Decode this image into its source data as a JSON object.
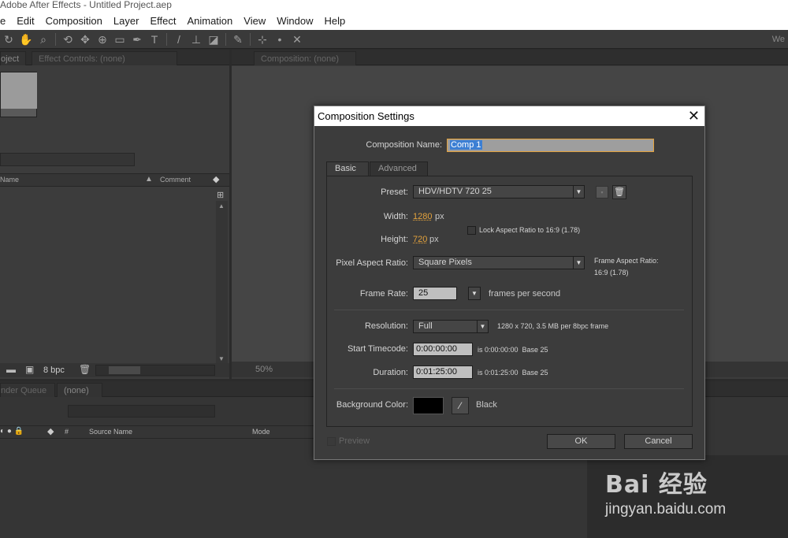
{
  "app": {
    "title": "Adobe After Effects - Untitled Project.aep",
    "menu": [
      "e",
      "Edit",
      "Composition",
      "Layer",
      "Effect",
      "Animation",
      "View",
      "Window",
      "Help"
    ],
    "workspace": "We"
  },
  "project_panel": {
    "tab_project": "oject",
    "tab_effect_controls": "Effect Controls: (none)",
    "col_name": "Name",
    "col_comment": "Comment",
    "bpc": "8 bpc"
  },
  "comp_panel": {
    "tab": "Composition: (none)",
    "zoom": "50%"
  },
  "timeline": {
    "tab_render_queue": "nder Queue",
    "tab_none": "(none)",
    "col_hash": "#",
    "col_source": "Source Name",
    "col_mode": "Mode"
  },
  "dialog": {
    "title": "Composition Settings",
    "comp_name_label": "Composition Name:",
    "comp_name_value": "Comp 1",
    "tabs": [
      "Basic",
      "Advanced"
    ],
    "preset_label": "Preset:",
    "preset_value": "HDV/HDTV 720 25",
    "width_label": "Width:",
    "width_value": "1280",
    "height_label": "Height:",
    "height_value": "720",
    "px": "px",
    "lock_aspect_label": "Lock Aspect Ratio to 16:9 (1.78)",
    "par_label": "Pixel Aspect Ratio:",
    "par_value": "Square Pixels",
    "frame_aspect_label": "Frame Aspect Ratio:",
    "frame_aspect_value": "16:9 (1.78)",
    "frame_rate_label": "Frame Rate:",
    "frame_rate_value": "25",
    "frames_per_second": "frames per second",
    "resolution_label": "Resolution:",
    "resolution_value": "Full",
    "resolution_info": "1280 x 720, 3.5 MB per 8bpc frame",
    "start_tc_label": "Start Timecode:",
    "start_tc_value": "0:00:00:00",
    "start_tc_info": "is 0:00:00:00  Base 25",
    "duration_label": "Duration:",
    "duration_value": "0:01:25:00",
    "duration_info": "is 0:01:25:00  Base 25",
    "bg_color_label": "Background Color:",
    "bg_color_name": "Black",
    "bg_color_hex": "#000000",
    "preview_label": "Preview",
    "ok_label": "OK",
    "cancel_label": "Cancel"
  },
  "watermark": {
    "brand": "Bai 经验",
    "url": "jingyan.baidu.com"
  }
}
